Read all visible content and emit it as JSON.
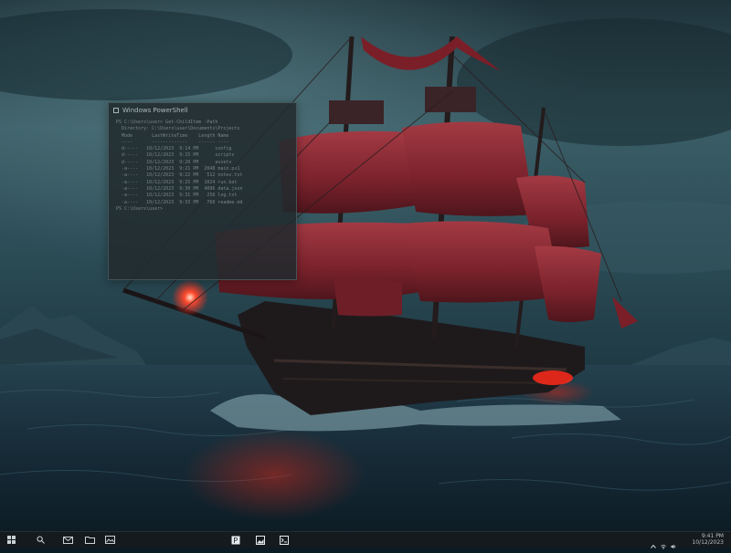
{
  "wallpaper": {
    "description_colors": {
      "sky": "#2b4a55",
      "sea": "#1c3342",
      "sails": "#8a2a33",
      "glow": "#ff3b2a"
    }
  },
  "terminal": {
    "title": "Windows PowerShell",
    "lines": [
      "PS C:\\Users\\user> Get-ChildItem -Path",
      "  Directory: C:\\Users\\user\\Documents\\Projects",
      "  Mode       LastWriteTime    Length Name",
      "  ----       -------------    ------ ----",
      "  d-----   10/12/2023  9:14 PM      config",
      "  d-----   10/12/2023  9:15 PM      scripts",
      "  d-----   10/12/2023  9:20 PM      assets",
      "  -a----   10/12/2023  9:21 PM  2048 main.ps1",
      "  -a----   10/12/2023  9:22 PM   512 notes.txt",
      "  -a----   10/12/2023  9:25 PM  1024 run.bat",
      "  -a----   10/12/2023  9:30 PM  4096 data.json",
      "  -a----   10/12/2023  9:31 PM   256 log.txt",
      "  -a----   10/12/2023  9:33 PM   768 readme.md",
      "PS C:\\Users\\user>"
    ]
  },
  "taskbar": {
    "start_icon": "windows-start-icon",
    "left_icons": [
      "search-icon",
      "task-view-icon",
      "mail-icon",
      "folder-icon",
      "image-icon"
    ],
    "center_icons": [
      "paint-app-icon",
      "photo-app-icon",
      "terminal-app-icon"
    ],
    "tray_icons": [
      "chevron-up-icon",
      "wifi-icon",
      "volume-icon"
    ],
    "time": "9:41 PM",
    "date": "10/12/2023"
  }
}
